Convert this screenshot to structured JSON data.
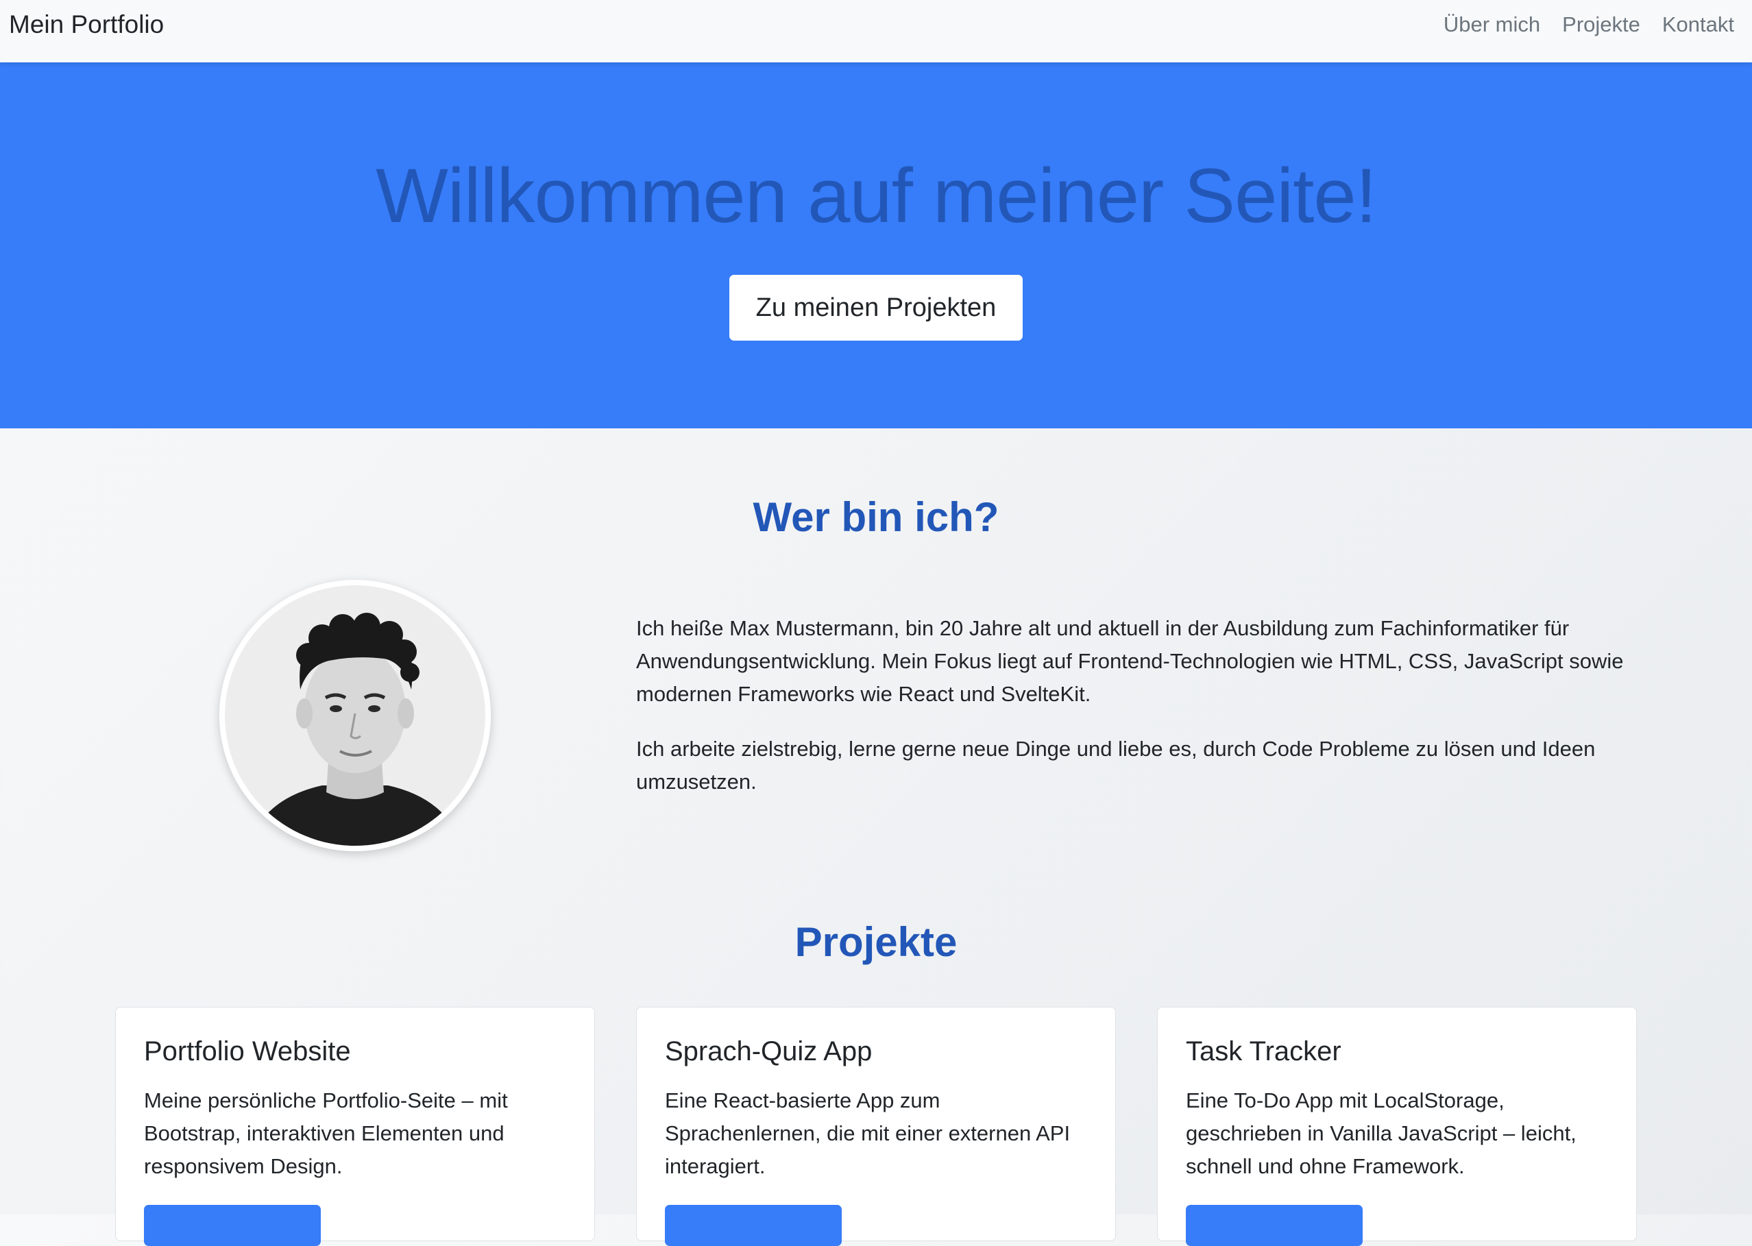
{
  "colors": {
    "accent": "#377cf8",
    "heading": "#2257b8",
    "navbar_bg": "#f8f9fa",
    "nav_link": "#6c757d",
    "text": "#212529"
  },
  "navbar": {
    "brand": "Mein Portfolio",
    "links": [
      "Über mich",
      "Projekte",
      "Kontakt"
    ]
  },
  "hero": {
    "title": "Willkommen auf meiner Seite!",
    "button_label": "Zu meinen Projekten"
  },
  "about": {
    "title": "Wer bin ich?",
    "avatar_icon": "profile-photo",
    "paragraphs": [
      "Ich heiße Max Mustermann, bin 20 Jahre alt und aktuell in der Ausbildung zum Fachinformatiker für Anwendungsentwicklung. Mein Fokus liegt auf Frontend-Technologien wie HTML, CSS, JavaScript sowie modernen Frameworks wie React und SvelteKit.",
      "Ich arbeite zielstrebig, lerne gerne neue Dinge und liebe es, durch Code Probleme zu lösen und Ideen umzusetzen."
    ]
  },
  "projects": {
    "title": "Projekte",
    "cards": [
      {
        "title": "Portfolio Website",
        "text": "Meine persönliche Portfolio-Seite – mit Bootstrap, interaktiven Elementen und responsivem Design."
      },
      {
        "title": "Sprach-Quiz App",
        "text": "Eine React-basierte App zum Sprachenlernen, die mit einer externen API interagiert."
      },
      {
        "title": "Task Tracker",
        "text": "Eine To-Do App mit LocalStorage, geschrieben in Vanilla JavaScript – leicht, schnell und ohne Framework."
      }
    ]
  }
}
